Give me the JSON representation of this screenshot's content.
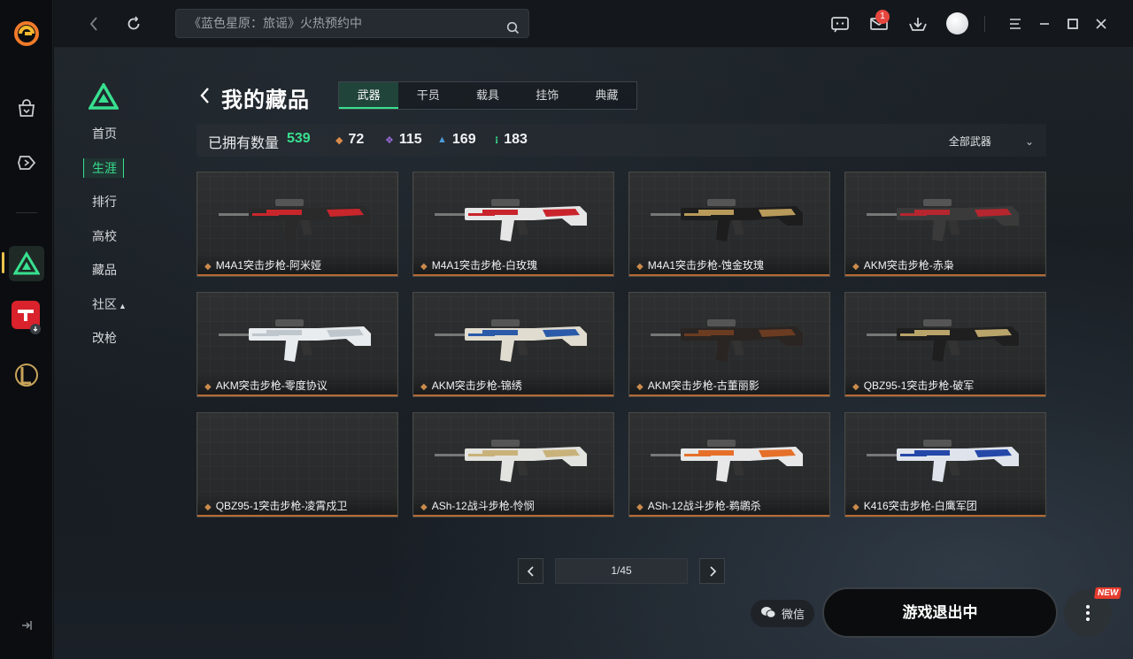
{
  "search": {
    "placeholder": "《蓝色星原：旅谣》火热预约中"
  },
  "topbar": {
    "mail_badge": "1"
  },
  "subnav": {
    "items": [
      {
        "label": "首页"
      },
      {
        "label": "生涯"
      },
      {
        "label": "排行"
      },
      {
        "label": "高校"
      },
      {
        "label": "藏品"
      },
      {
        "label": "社区"
      },
      {
        "label": "改枪"
      }
    ]
  },
  "header": {
    "title": "我的藏品",
    "tabs": [
      {
        "label": "武器",
        "active": true
      },
      {
        "label": "干员"
      },
      {
        "label": "载具"
      },
      {
        "label": "挂饰"
      },
      {
        "label": "典藏"
      }
    ]
  },
  "stats": {
    "label": "已拥有数量",
    "total": "539",
    "counts": [
      {
        "value": "72",
        "color": "#d88a4a"
      },
      {
        "value": "115",
        "color": "#9a6ad8"
      },
      {
        "value": "169",
        "color": "#4a9ad8"
      },
      {
        "value": "183",
        "color": "#38e08f"
      }
    ],
    "filter": "全部武器"
  },
  "items": [
    {
      "name": "M4A1突击步枪-阿米娅",
      "accent": "#c8262b",
      "base": "#2a2a2a"
    },
    {
      "name": "M4A1突击步枪-白玫瑰",
      "accent": "#c9242c",
      "base": "#e6e6e6"
    },
    {
      "name": "M4A1突击步枪-蚀金玫瑰",
      "accent": "#b89a5a",
      "base": "#1d1d1d"
    },
    {
      "name": "AKM突击步枪-赤枭",
      "accent": "#b5262e",
      "base": "#3a3a3a"
    },
    {
      "name": "AKM突击步枪-零度协议",
      "accent": "#bfc6cc",
      "base": "#e8ecef"
    },
    {
      "name": "AKM突击步枪-锦绣",
      "accent": "#2a5aa8",
      "base": "#e0dccf"
    },
    {
      "name": "AKM突击步枪-古董丽影",
      "accent": "#6b3c22",
      "base": "#2a2522"
    },
    {
      "name": "QBZ95-1突击步枪-破军",
      "accent": "#b9a56a",
      "base": "#1f1f1f"
    },
    {
      "name": "QBZ95-1突击步枪-凌霄戍卫",
      "accent": "",
      "base": ""
    },
    {
      "name": "ASh-12战斗步枪-怜悯",
      "accent": "#c9b27a",
      "base": "#e3e3df"
    },
    {
      "name": "ASh-12战斗步枪-鹈鹕杀",
      "accent": "#e5702a",
      "base": "#e8e8e8"
    },
    {
      "name": "K416突击步枪-白鹰军团",
      "accent": "#2447a8",
      "base": "#dfe4ec"
    }
  ],
  "pagination": {
    "info": "1/45"
  },
  "bottom": {
    "wechat": "微信",
    "play": "游戏退出中",
    "new": "NEW"
  }
}
